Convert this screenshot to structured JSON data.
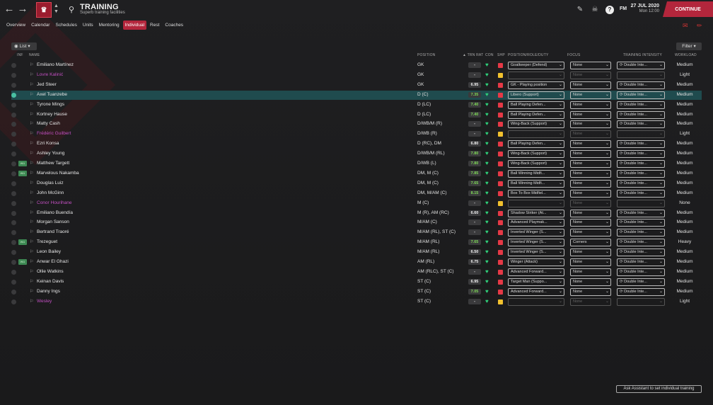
{
  "header": {
    "back_icon": "arrow-left-icon",
    "forward_icon": "arrow-right-icon",
    "title": "TRAINING",
    "subtitle": "Superb training facilities",
    "fm_label": "FM",
    "date": "27 JUL 2020",
    "time": "Mon 12:00",
    "continue_label": "CONTINUE",
    "continue_color": "#b3263c"
  },
  "tabs": [
    "Overview",
    "Calendar",
    "Schedules",
    "Units",
    "Mentoring",
    "Individual",
    "Rest",
    "Coaches"
  ],
  "active_tab": "Individual",
  "toolbar": {
    "list_label": "List",
    "filter_label": "Filter"
  },
  "columns": {
    "inf": "INF",
    "name": "NAME",
    "position": "POSITION",
    "trn_rat": "TRN RAT",
    "con": "CON",
    "shp": "SHP",
    "role": "POSITION/ROLE/DUTY",
    "focus": "FOCUS",
    "intensity": "TRAINING INTENSITY",
    "workload": "WORKLOAD"
  },
  "players": [
    {
      "name": "Emiliano Martínez",
      "loan": false,
      "badge": "",
      "pos": "GK",
      "rating": "-",
      "shp": "r",
      "role": "Goalkeeper (Defend)",
      "focus": "None",
      "intensity": "Double Inte...",
      "workload": "Medium",
      "enabled": true
    },
    {
      "name": "Lovre Kalinić",
      "loan": true,
      "badge": "",
      "pos": "GK",
      "rating": "-",
      "shp": "y",
      "role": "",
      "focus": "None",
      "intensity": "",
      "workload": "Light",
      "enabled": false
    },
    {
      "name": "Jed Steer",
      "loan": false,
      "badge": "",
      "pos": "GK",
      "rating": "6.95",
      "shp": "r",
      "role": "GK - Playing position",
      "focus": "None",
      "intensity": "Double Inte...",
      "workload": "Medium",
      "enabled": true
    },
    {
      "name": "Axel Tuanzebe",
      "loan": false,
      "badge": "",
      "pos": "D (C)",
      "rating": "7.35",
      "shp": "r",
      "role": "Libero (Support)",
      "focus": "None",
      "intensity": "Double Inte...",
      "workload": "Medium",
      "enabled": true,
      "selected": true
    },
    {
      "name": "Tyrone Mings",
      "loan": false,
      "badge": "",
      "pos": "D (LC)",
      "rating": "7.40",
      "shp": "r",
      "role": "Ball Playing Defen...",
      "focus": "None",
      "intensity": "Double Inte...",
      "workload": "Medium",
      "enabled": true
    },
    {
      "name": "Kortney Hause",
      "loan": false,
      "badge": "",
      "pos": "D (LC)",
      "rating": "7.40",
      "shp": "r",
      "role": "Ball Playing Defen...",
      "focus": "None",
      "intensity": "Double Inte...",
      "workload": "Medium",
      "enabled": true
    },
    {
      "name": "Matty Cash",
      "loan": false,
      "badge": "",
      "pos": "D/WB/M (R)",
      "rating": "-",
      "shp": "r",
      "role": "Wing-Back (Support)",
      "focus": "None",
      "intensity": "Double Inte...",
      "workload": "Medium",
      "enabled": true
    },
    {
      "name": "Frédéric Guilbert",
      "loan": true,
      "badge": "",
      "pos": "D/WB (R)",
      "rating": "-",
      "shp": "y",
      "role": "",
      "focus": "None",
      "intensity": "",
      "workload": "Light",
      "enabled": false
    },
    {
      "name": "Ezri Konsa",
      "loan": false,
      "badge": "",
      "pos": "D (RC), DM",
      "rating": "6.80",
      "shp": "r",
      "role": "Ball Playing Defen...",
      "focus": "None",
      "intensity": "Double Inte...",
      "workload": "Medium",
      "enabled": true
    },
    {
      "name": "Ashley Young",
      "loan": false,
      "badge": "",
      "pos": "D/WB/M (RL)",
      "rating": "7.80",
      "shp": "r",
      "role": "Wing-Back (Support)",
      "focus": "None",
      "intensity": "Double Inte...",
      "workload": "Medium",
      "enabled": true
    },
    {
      "name": "Matthew Targett",
      "loan": false,
      "badge": "WU",
      "pos": "D/WB (L)",
      "rating": "7.80",
      "shp": "r",
      "role": "Wing-Back (Support)",
      "focus": "None",
      "intensity": "Double Inte...",
      "workload": "Medium",
      "enabled": true
    },
    {
      "name": "Marvelous Nakamba",
      "loan": false,
      "badge": "WU",
      "pos": "DM, M (C)",
      "rating": "7.85",
      "shp": "r",
      "role": "Ball Winning Midfi...",
      "focus": "None",
      "intensity": "Double Inte...",
      "workload": "Medium",
      "enabled": true
    },
    {
      "name": "Douglas Luiz",
      "loan": false,
      "badge": "",
      "pos": "DM, M (C)",
      "rating": "7.65",
      "shp": "r",
      "role": "Ball Winning Midfi...",
      "focus": "None",
      "intensity": "Double Inte...",
      "workload": "Medium",
      "enabled": true
    },
    {
      "name": "John McGinn",
      "loan": false,
      "badge": "",
      "pos": "DM, M/AM (C)",
      "rating": "8.15",
      "shp": "r",
      "role": "Box To Box Midfiel...",
      "focus": "None",
      "intensity": "Double Inte...",
      "workload": "Medium",
      "enabled": true
    },
    {
      "name": "Conor Hourihane",
      "loan": true,
      "badge": "",
      "pos": "M (C)",
      "rating": "-",
      "shp": "y",
      "role": "",
      "focus": "None",
      "intensity": "",
      "workload": "None",
      "enabled": false
    },
    {
      "name": "Emiliano Buendía",
      "loan": false,
      "badge": "",
      "pos": "M (R), AM (RC)",
      "rating": "6.60",
      "shp": "r",
      "role": "Shadow Striker (At...",
      "focus": "None",
      "intensity": "Double Inte...",
      "workload": "Medium",
      "enabled": true
    },
    {
      "name": "Morgan Sanson",
      "loan": false,
      "badge": "",
      "pos": "M/AM (C)",
      "rating": "-",
      "shp": "r",
      "role": "Advanced Playmak...",
      "focus": "None",
      "intensity": "Double Inte...",
      "workload": "Medium",
      "enabled": true
    },
    {
      "name": "Bertrand Traoré",
      "loan": false,
      "badge": "",
      "pos": "M/AM (RL), ST (C)",
      "rating": "-",
      "shp": "r",
      "role": "Inverted Winger (S...",
      "focus": "None",
      "intensity": "Double Inte...",
      "workload": "Medium",
      "enabled": true
    },
    {
      "name": "Trezeguet",
      "loan": false,
      "badge": "WU",
      "pos": "M/AM (RL)",
      "rating": "7.65",
      "shp": "r",
      "role": "Inverted Winger (S...",
      "focus": "Corners",
      "intensity": "Double Inte...",
      "workload": "Heavy",
      "enabled": true
    },
    {
      "name": "Leon Bailey",
      "loan": false,
      "badge": "",
      "pos": "M/AM (RL)",
      "rating": "6.50",
      "shp": "r",
      "role": "Inverted Winger (S...",
      "focus": "None",
      "intensity": "Double Inte...",
      "workload": "Medium",
      "enabled": true
    },
    {
      "name": "Anwar El Ghazi",
      "loan": false,
      "badge": "WU",
      "pos": "AM (RL)",
      "rating": "6.75",
      "shp": "r",
      "role": "Winger (Attack)",
      "focus": "None",
      "intensity": "Double Inte...",
      "workload": "Medium",
      "enabled": true
    },
    {
      "name": "Ollie Watkins",
      "loan": false,
      "badge": "",
      "pos": "AM (RLC), ST (C)",
      "rating": "-",
      "shp": "r",
      "role": "Advanced Forward...",
      "focus": "None",
      "intensity": "Double Inte...",
      "workload": "Medium",
      "enabled": true
    },
    {
      "name": "Keinan Davis",
      "loan": false,
      "badge": "",
      "pos": "ST (C)",
      "rating": "6.95",
      "shp": "r",
      "role": "Target Man (Suppo...",
      "focus": "None",
      "intensity": "Double Inte...",
      "workload": "Medium",
      "enabled": true
    },
    {
      "name": "Danny Ings",
      "loan": false,
      "badge": "",
      "pos": "ST (C)",
      "rating": "7.05",
      "shp": "r",
      "role": "Advanced Forward...",
      "focus": "None",
      "intensity": "Double Inte...",
      "workload": "Medium",
      "enabled": true
    },
    {
      "name": "Wesley",
      "loan": true,
      "badge": "",
      "pos": "ST (C)",
      "rating": "-",
      "shp": "y",
      "role": "",
      "focus": "None",
      "intensity": "",
      "workload": "Light",
      "enabled": false
    }
  ],
  "assist_label": "Ask Assistant to set individual training",
  "colors": {
    "accent": "#b3263c",
    "loan": "#c24fc2",
    "selected_row": "#1f4b4e",
    "good_rating": "#7ed957",
    "condition": "#2fd07a"
  }
}
